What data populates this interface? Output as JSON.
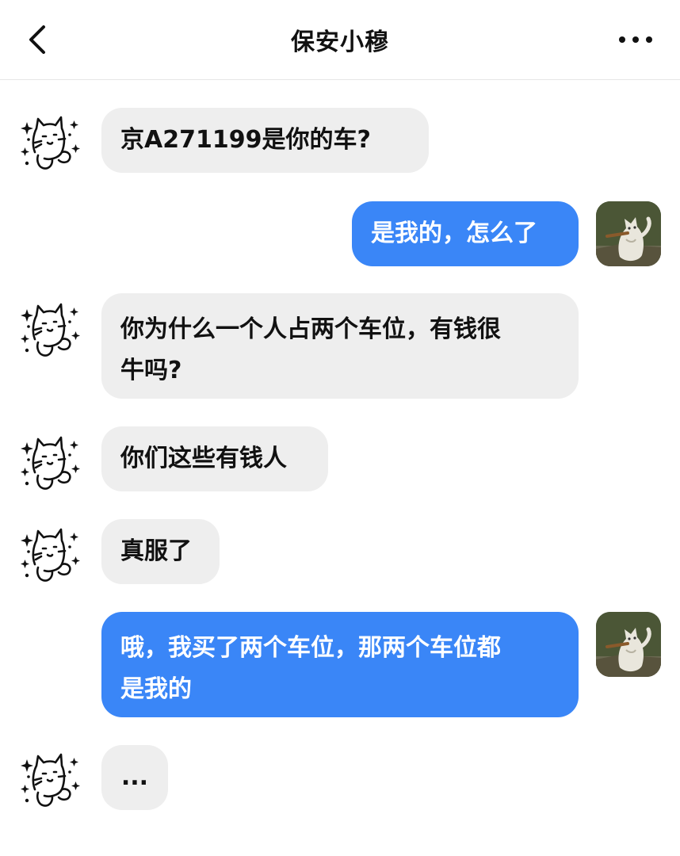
{
  "header": {
    "title": "保安小穆",
    "back_icon": "chevron-left-icon",
    "more_icon": "more-dots-icon"
  },
  "colors": {
    "incoming_bubble": "#eeeeee",
    "outgoing_bubble": "#3a86f7",
    "outgoing_text": "#ffffff"
  },
  "messages": [
    {
      "sender": "other",
      "text": "京A271199是你的车?"
    },
    {
      "sender": "me",
      "text": "是我的，怎么了"
    },
    {
      "sender": "other",
      "text": "你为什么一个人占两个车位，有钱很\n牛吗?"
    },
    {
      "sender": "other",
      "text": "你们这些有钱人"
    },
    {
      "sender": "other",
      "text": "真服了"
    },
    {
      "sender": "me",
      "text": "哦，我买了两个车位，那两个车位都\n是我的"
    },
    {
      "sender": "other",
      "text": "..."
    }
  ]
}
